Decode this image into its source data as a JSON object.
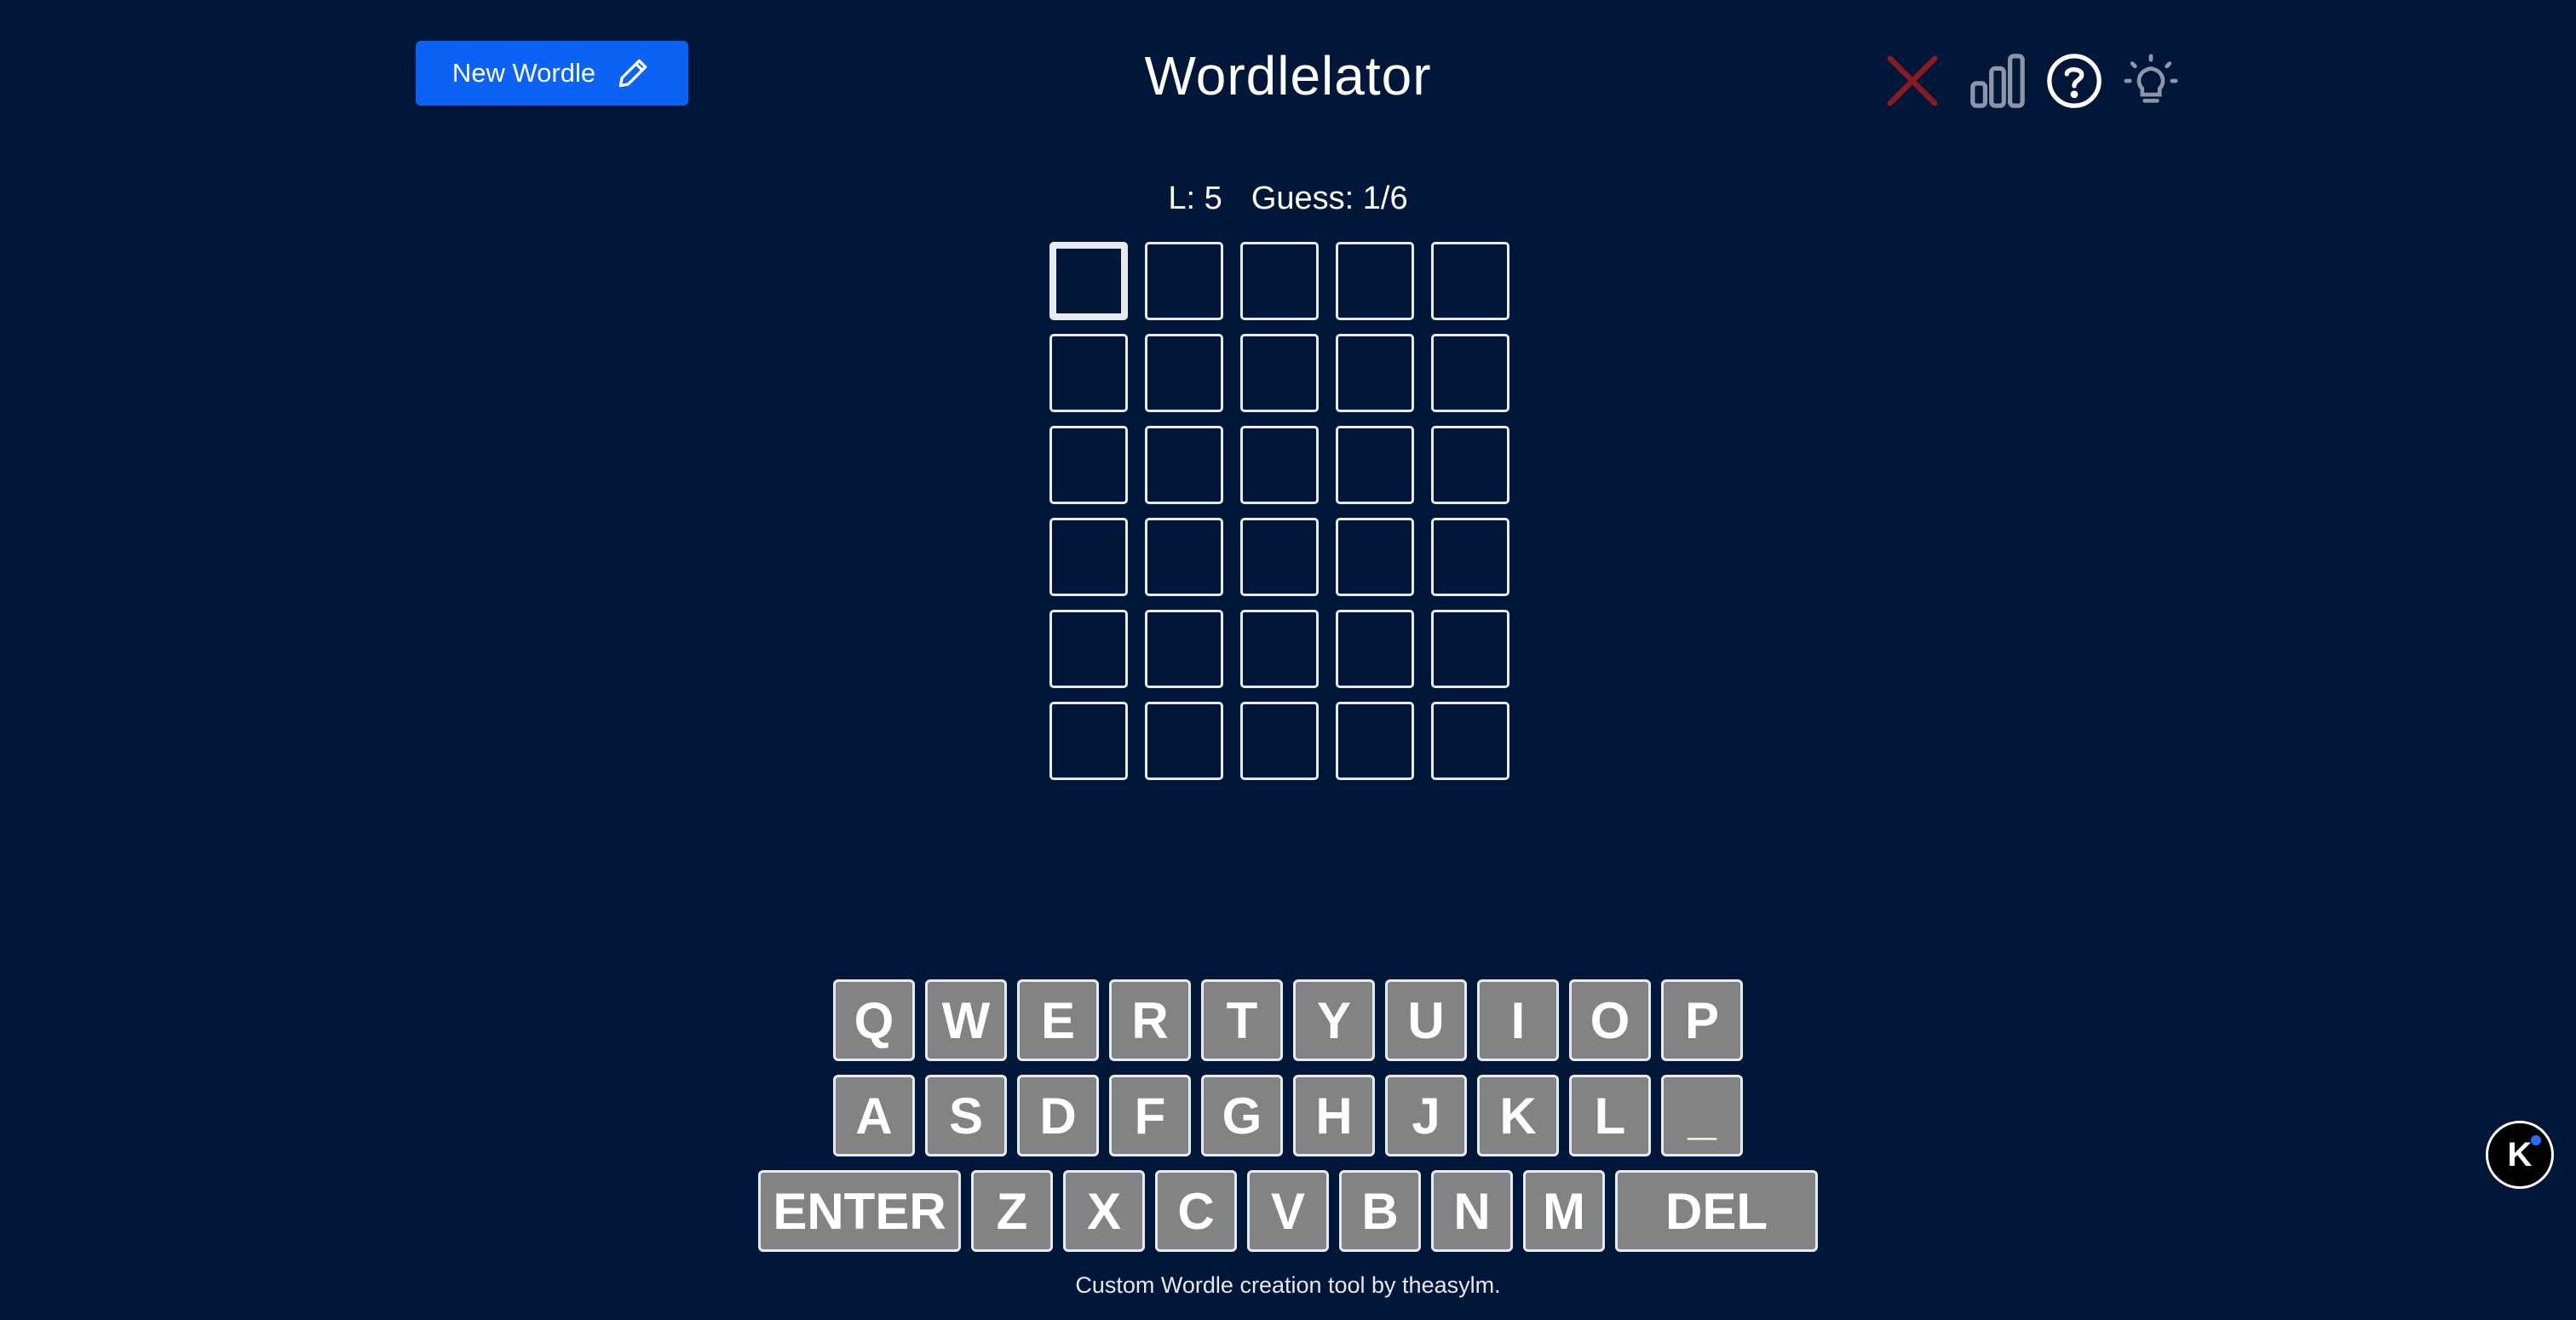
{
  "header": {
    "new_button_label": "New Wordle",
    "title": "Wordlelator",
    "icons": [
      "close-icon",
      "stats-icon",
      "help-icon",
      "hint-bulb-icon"
    ]
  },
  "status": {
    "length_label": "L: 5",
    "guess_label": "Guess: 1/6"
  },
  "board": {
    "rows": 6,
    "columns": 5,
    "active_cell": [
      0,
      0
    ]
  },
  "keyboard": {
    "row1": [
      "Q",
      "W",
      "E",
      "R",
      "T",
      "Y",
      "U",
      "I",
      "O",
      "P"
    ],
    "row2": [
      "A",
      "S",
      "D",
      "F",
      "G",
      "H",
      "J",
      "K",
      "L",
      "_"
    ],
    "row3": [
      "ENTER",
      "Z",
      "X",
      "C",
      "V",
      "B",
      "N",
      "M",
      "DEL"
    ]
  },
  "footer": {
    "text": "Custom Wordle creation tool by theasylm."
  },
  "badge": {
    "label": "K"
  },
  "colors": {
    "background": "#01173a",
    "primary_button": "#0b63f6",
    "key": "#828384",
    "close_icon": "#8b1a22"
  }
}
